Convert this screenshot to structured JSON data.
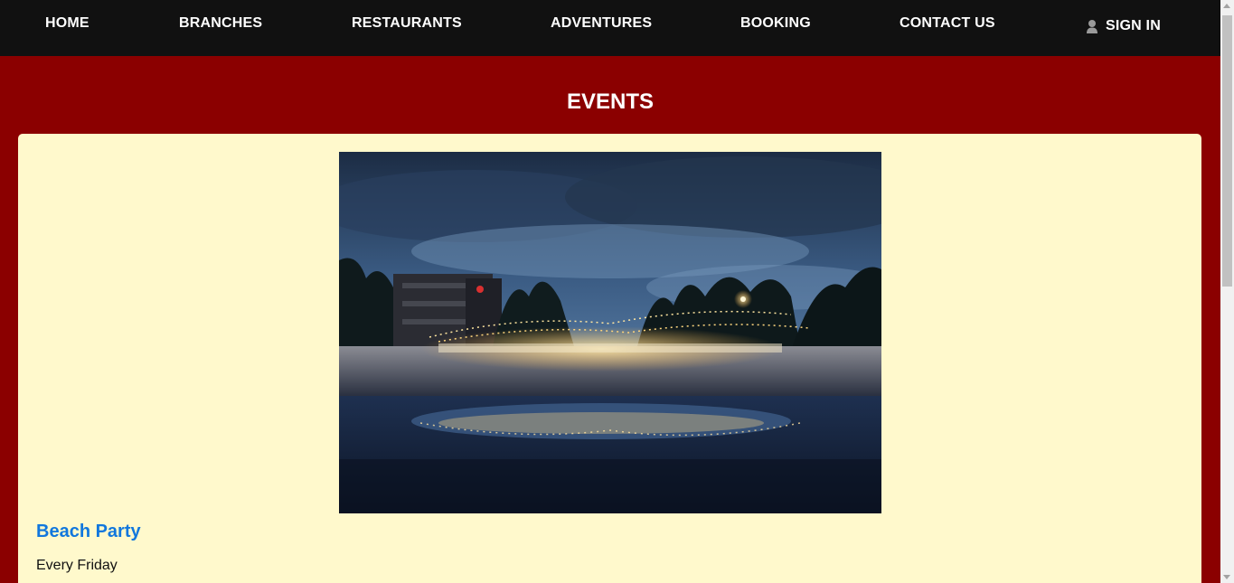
{
  "nav": {
    "home": "HOME",
    "branches": "BRANCHES",
    "restaurants": "RESTAURANTS",
    "adventures": "ADVENTURES",
    "booking": "BOOKING",
    "contact": "CONTACT US",
    "sign_in": "SIGN IN",
    "sign_in_icon": "user-icon"
  },
  "page": {
    "title": "EVENTS"
  },
  "event": {
    "image_alt": "Beach party at night with string lights",
    "name": "Beach Party",
    "schedule": "Every Friday"
  },
  "colors": {
    "nav_bg": "#111111",
    "page_bg": "#8b0000",
    "card_bg": "#fff9cc",
    "event_name": "#1177dd"
  }
}
